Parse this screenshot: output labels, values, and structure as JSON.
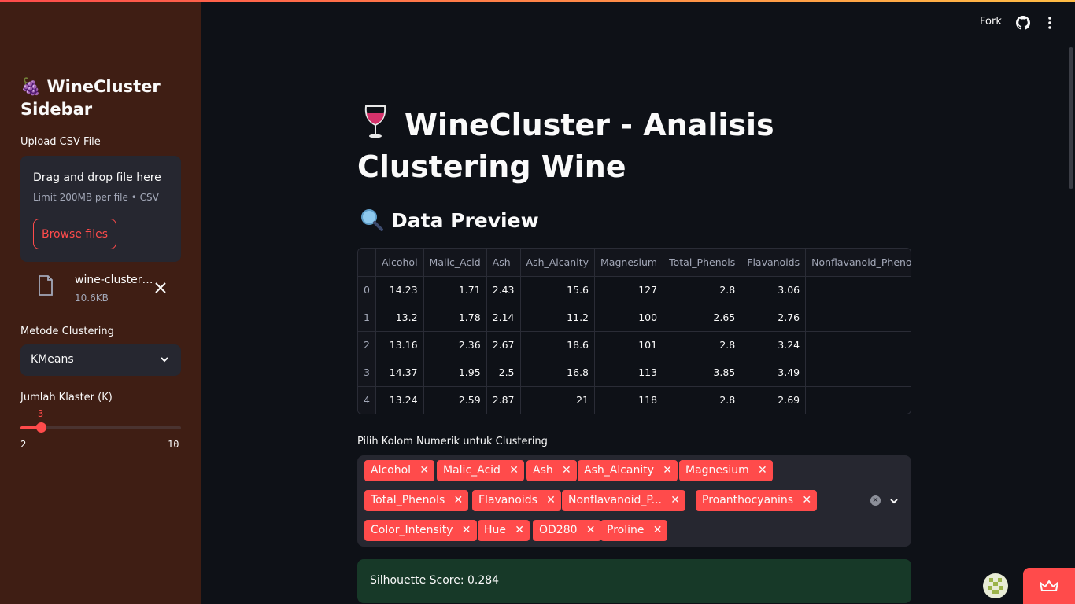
{
  "sidebar": {
    "title": "🍇 WineCluster Sidebar",
    "upload_label": "Upload CSV File",
    "drop_title": "Drag and drop file here",
    "drop_subtitle": "Limit 200MB per file • CSV",
    "browse_label": "Browse files",
    "file_name": "wine-clustering.csv",
    "file_size": "10.6KB",
    "method_label": "Metode Clustering",
    "method_value": "KMeans",
    "k_label": "Jumlah Klaster (K)",
    "k_value": "3",
    "k_min": "2",
    "k_max": "10",
    "k_fraction": 0.125
  },
  "header": {
    "fork_label": "Fork",
    "github_icon": "github-icon",
    "menu_icon": "kebab-menu-icon"
  },
  "main": {
    "title": "WineCluster - Analisis Clustering Wine",
    "preview_heading": "Data Preview",
    "table": {
      "columns": [
        "",
        "Alcohol",
        "Malic_Acid",
        "Ash",
        "Ash_Alcanity",
        "Magnesium",
        "Total_Phenols",
        "Flavanoids",
        "Nonflavanoid_Phenols"
      ],
      "rows": [
        [
          "0",
          "14.23",
          "1.71",
          "2.43",
          "15.6",
          "127",
          "2.8",
          "3.06",
          ""
        ],
        [
          "1",
          "13.2",
          "1.78",
          "2.14",
          "11.2",
          "100",
          "2.65",
          "2.76",
          ""
        ],
        [
          "2",
          "13.16",
          "2.36",
          "2.67",
          "18.6",
          "101",
          "2.8",
          "3.24",
          ""
        ],
        [
          "3",
          "14.37",
          "1.95",
          "2.5",
          "16.8",
          "113",
          "3.85",
          "3.49",
          ""
        ],
        [
          "4",
          "13.24",
          "2.59",
          "2.87",
          "21",
          "118",
          "2.8",
          "2.69",
          ""
        ]
      ]
    },
    "multiselect_label": "Pilih Kolom Numerik untuk Clustering",
    "tags": [
      "Alcohol",
      "Malic_Acid",
      "Ash",
      "Ash_Alcanity",
      "Magnesium",
      "Total_Phenols",
      "Flavanoids",
      "Nonflavanoid_P...",
      "Proanthocyanins",
      "Color_Intensity",
      "Hue",
      "OD280",
      "Proline"
    ],
    "score_text": "Silhouette Score: 0.284"
  },
  "colors": {
    "accent": "#ff4b4b",
    "sidebar_bg": "#3f1e14",
    "main_bg": "#0e1117",
    "success_bg": "#173928"
  }
}
